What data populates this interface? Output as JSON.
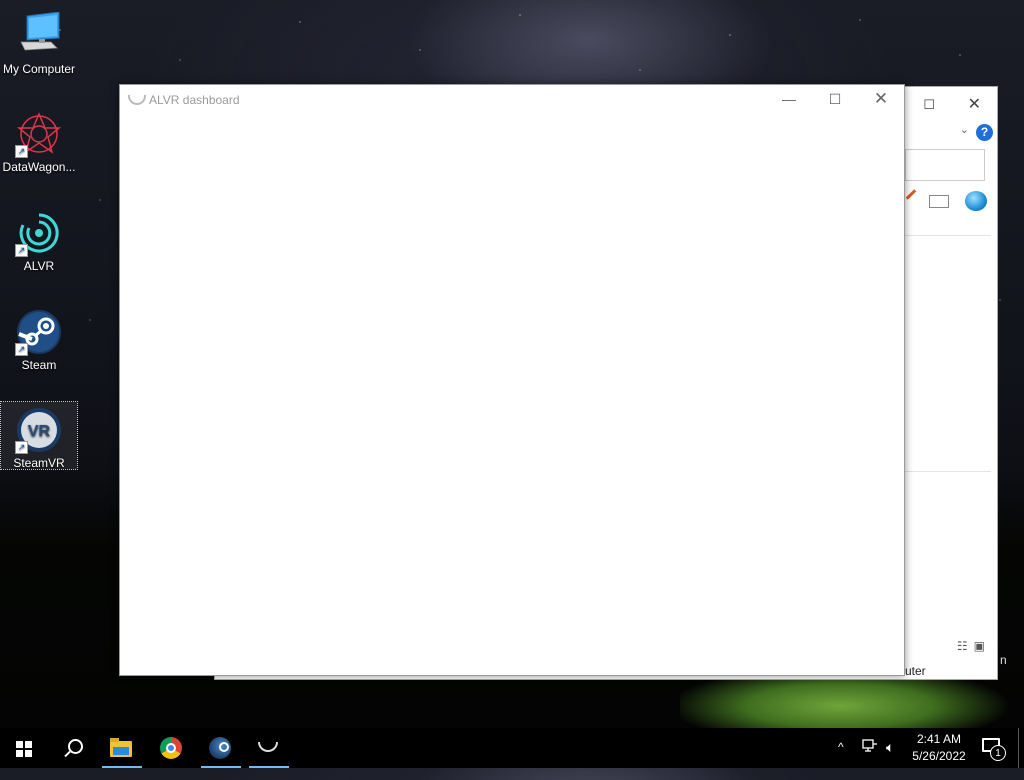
{
  "desktop": {
    "icons": [
      {
        "label": "My Computer",
        "icon": "computer-icon"
      },
      {
        "label": "DataWagon...",
        "icon": "datawagon-icon"
      },
      {
        "label": "ALVR",
        "icon": "alvr-icon"
      },
      {
        "label": "Steam",
        "icon": "steam-icon"
      },
      {
        "label": "SteamVR",
        "icon": "steamvr-icon",
        "selected": true
      }
    ]
  },
  "vr_badge": "VR",
  "background_window": {
    "status_text": "uter",
    "help_label": "?",
    "edge_text": "n"
  },
  "alvr_window": {
    "title": "ALVR dashboard"
  },
  "taskbar": {
    "apps": [
      {
        "name": "start-button",
        "icon": "windows-icon"
      },
      {
        "name": "search-button",
        "icon": "search-icon"
      },
      {
        "name": "file-explorer",
        "icon": "folder-icon",
        "active": true
      },
      {
        "name": "chrome",
        "icon": "chrome-icon"
      },
      {
        "name": "steam",
        "icon": "steam-icon",
        "active": true
      },
      {
        "name": "alvr",
        "icon": "alvr-icon",
        "active": true
      }
    ],
    "clock": {
      "time": "2:41 AM",
      "date": "5/26/2022"
    },
    "notification_count": "1"
  }
}
